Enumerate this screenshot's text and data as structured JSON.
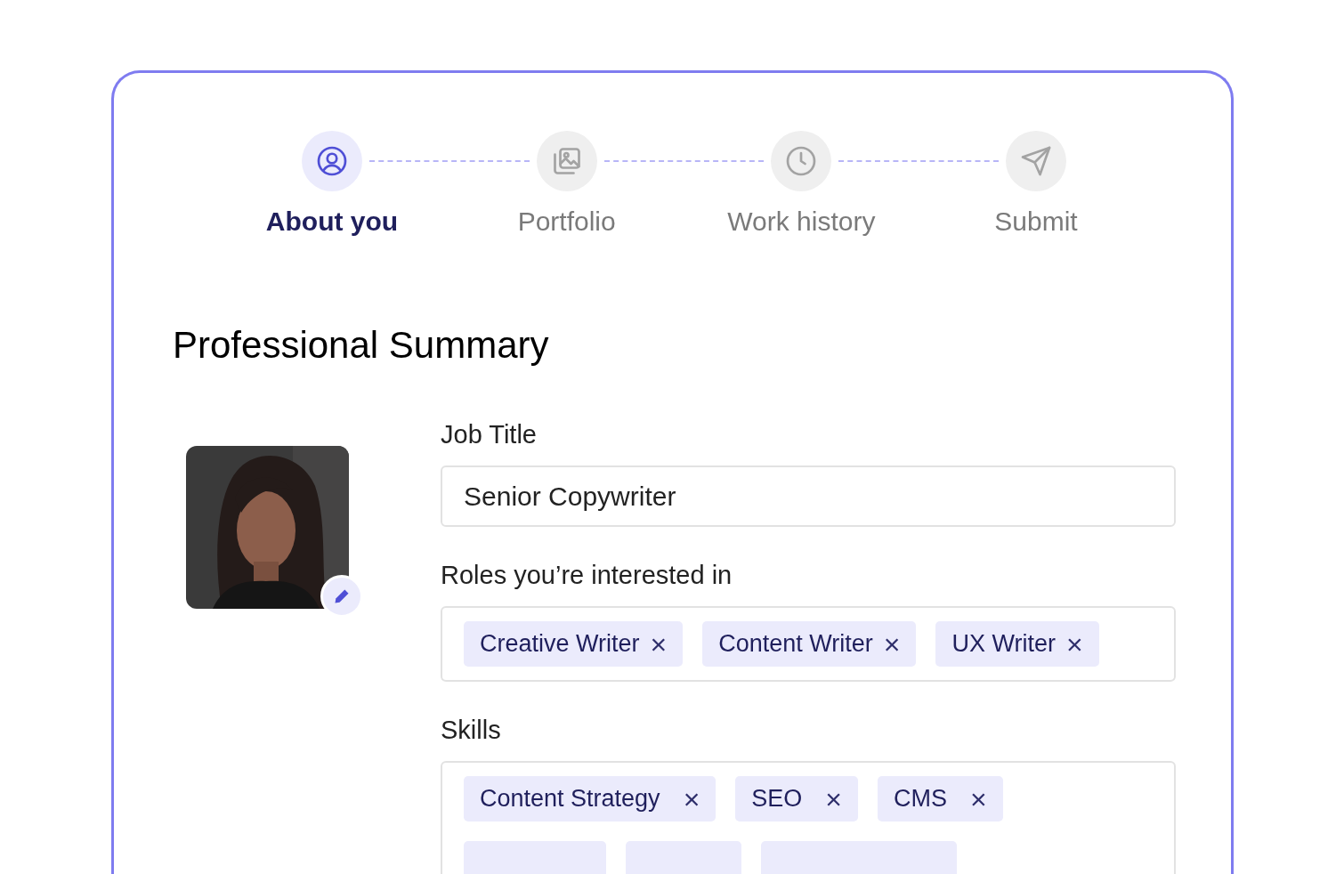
{
  "steps": [
    {
      "label": "About you",
      "selected": true
    },
    {
      "label": "Portfolio",
      "selected": false
    },
    {
      "label": "Work history",
      "selected": false
    },
    {
      "label": "Submit",
      "selected": false
    }
  ],
  "heading": "Professional Summary",
  "fields": [
    {
      "kind": "text",
      "label": "Job Title",
      "value": "Senior Copywriter"
    },
    {
      "kind": "tags",
      "label": "Roles you’re interested in",
      "tags": [
        {
          "kind": "tag",
          "label": "Creative Writer",
          "remove": "×"
        },
        {
          "kind": "tag",
          "label": "Content Writer",
          "remove": "×"
        },
        {
          "kind": "tag",
          "label": "UX Writer",
          "remove": "×"
        }
      ]
    },
    {
      "kind": "tags",
      "label": "Skills",
      "tags": [
        {
          "kind": "tag",
          "label": "Content Strategy",
          "remove": "×"
        },
        {
          "kind": "tag",
          "label": "SEO",
          "remove": "×"
        },
        {
          "kind": "tag",
          "label": "CMS",
          "remove": "×"
        },
        {
          "kind": "clipped"
        },
        {
          "kind": "clipped"
        },
        {
          "kind": "clipped"
        }
      ]
    }
  ]
}
